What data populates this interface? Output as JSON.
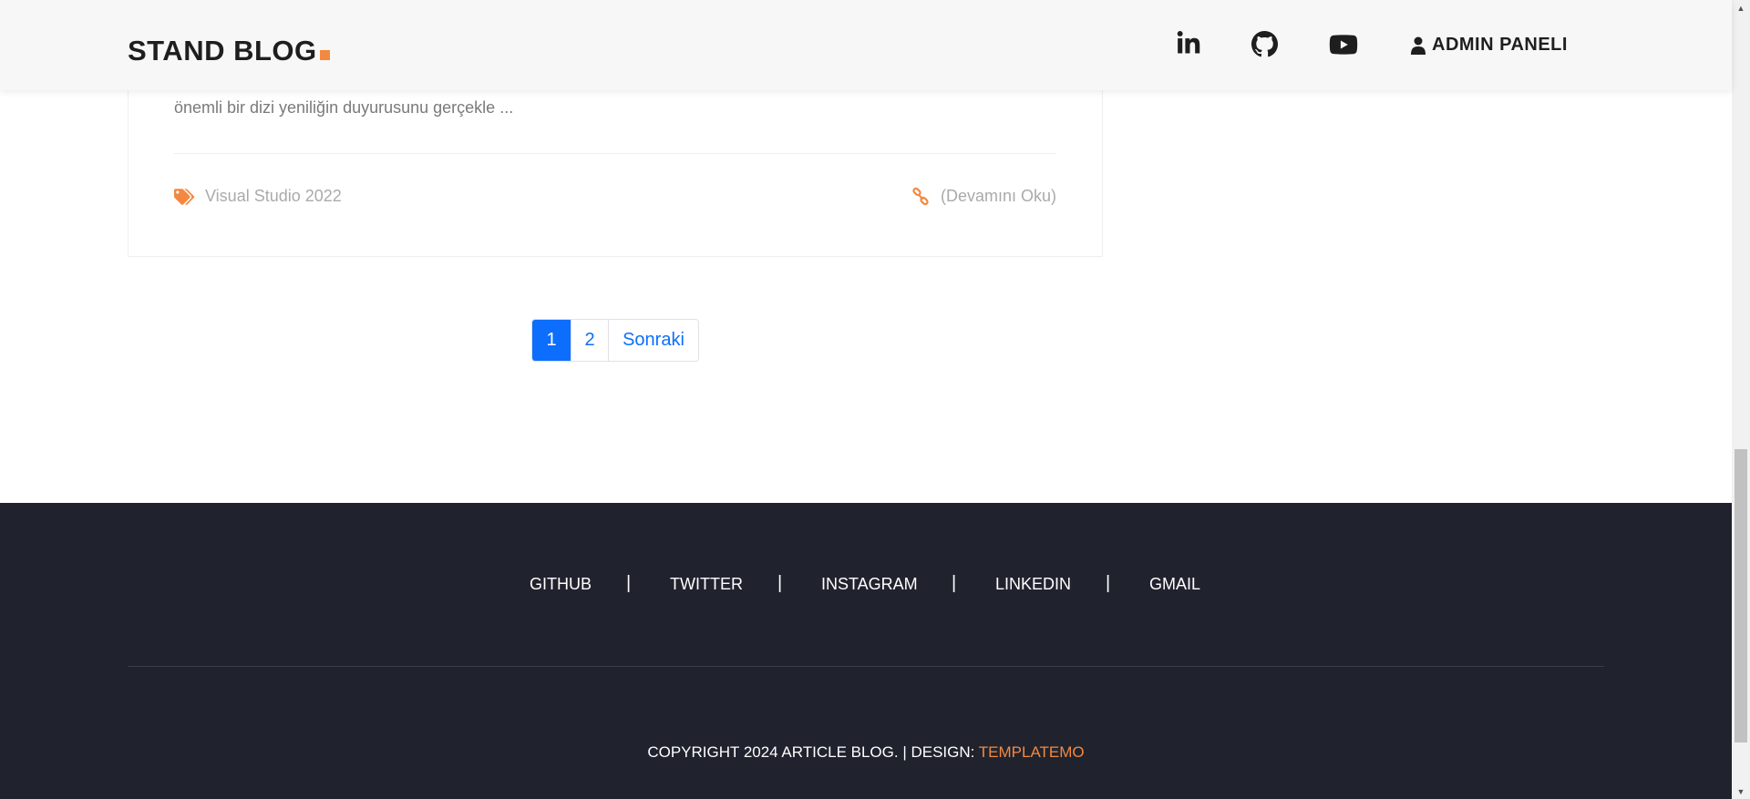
{
  "header": {
    "logo_text": "STAND BLOG",
    "admin_label": "ADMIN PANELI",
    "icons": [
      "linkedin-icon",
      "github-icon",
      "youtube-icon",
      "user-icon"
    ]
  },
  "article": {
    "excerpt": "önemli bir dizi yeniliğin duyurusunu gerçekle ...",
    "tag": "Visual Studio 2022",
    "read_more": "(Devamını Oku)"
  },
  "pagination": {
    "pages": [
      "1",
      "2"
    ],
    "next": "Sonraki",
    "active_page": "1"
  },
  "footer": {
    "links": [
      "GITHUB",
      "TWITTER",
      "INSTAGRAM",
      "LINKEDIN",
      "GMAIL"
    ],
    "separator": "|",
    "copyright_prefix": "COPYRIGHT 2024 ARTICLE BLOG. | DESIGN: ",
    "copyright_link": "TEMPLATEMO"
  },
  "colors": {
    "accent": "#f48840",
    "primary": "#0d6efd",
    "footer_bg": "#20232e"
  }
}
